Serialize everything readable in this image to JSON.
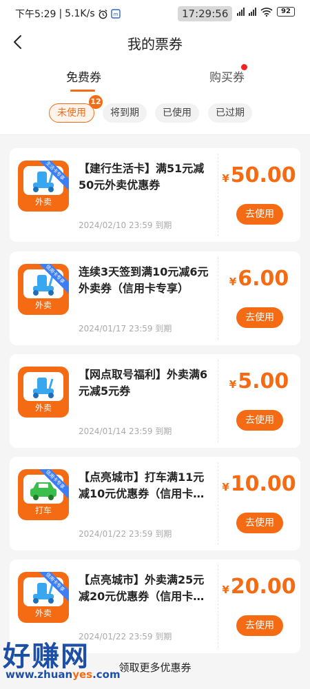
{
  "status_bar": {
    "time": "下午5:29",
    "speed": "5.1K/s",
    "clock": "17:29:56",
    "battery": "92"
  },
  "header": {
    "title": "我的票券"
  },
  "tabs": [
    {
      "label": "免费券",
      "active": true
    },
    {
      "label": "购买券",
      "active": false,
      "has_dot": true
    }
  ],
  "filters": [
    {
      "label": "未使用",
      "active": true,
      "badge": "12"
    },
    {
      "label": "将到期",
      "active": false
    },
    {
      "label": "已使用",
      "active": false
    },
    {
      "label": "已过期",
      "active": false
    }
  ],
  "coupons": [
    {
      "title": "【建行生活卡】满51元减50元外卖优惠券",
      "currency": "¥",
      "price": "50.00",
      "expiry": "2024/02/10 23:59 到期",
      "category": "外卖",
      "icon": "scooter-icon",
      "ribbon": true,
      "button": "去使用"
    },
    {
      "title": "连续3天签到满10元减6元外卖券（信用卡专享）",
      "currency": "¥",
      "price": "6.00",
      "expiry": "2024/01/17 23:59 到期",
      "category": "外卖",
      "icon": "scooter-icon",
      "ribbon": true,
      "button": "去使用"
    },
    {
      "title": "【网点取号福利】外卖满6元减5元券",
      "currency": "¥",
      "price": "5.00",
      "expiry": "2024/01/14 23:59 到期",
      "category": "外卖",
      "icon": "scooter-icon",
      "ribbon": false,
      "button": "去使用"
    },
    {
      "title": "【点亮城市】打车满11元减10元优惠券（信用卡…",
      "currency": "¥",
      "price": "10.00",
      "expiry": "2024/01/22 23:59 到期",
      "category": "打车",
      "icon": "car-icon",
      "ribbon": true,
      "button": "去使用"
    },
    {
      "title": "【点亮城市】外卖满25元减20元优惠券（信用卡…",
      "currency": "¥",
      "price": "20.00",
      "expiry": "2024/01/22 23:59 到期",
      "category": "外卖",
      "icon": "scooter-icon",
      "ribbon": true,
      "button": "去使用"
    }
  ],
  "footer": {
    "more_link": "领取更多优惠券"
  },
  "watermark": {
    "brand": "好赚网",
    "url_a": "www.zhuan",
    "url_b": "yes",
    "url_c": ".com"
  },
  "colors": {
    "accent": "#f46b14",
    "ribbon": "#3d7ef5",
    "dot": "#f4221f"
  }
}
